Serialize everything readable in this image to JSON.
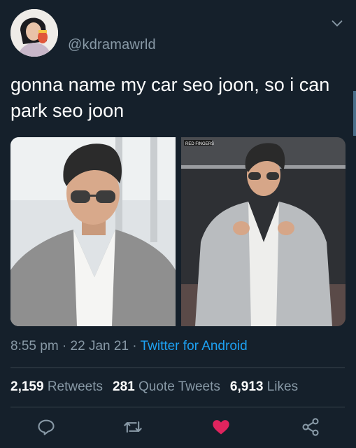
{
  "user": {
    "handle": "@kdramawrld",
    "avatar_icon": "profile-photo"
  },
  "tweet": {
    "text": "gonna name my car seo joon, so i can park seo joon",
    "image_watermark": "RED FINGERS"
  },
  "meta": {
    "time": "8:55 pm",
    "separator": " · ",
    "date": "22 Jan 21",
    "source": "Twitter for Android"
  },
  "stats": {
    "retweets_count": "2,159",
    "retweets_label": "Retweets",
    "quote_count": "281",
    "quote_label": "Quote Tweets",
    "likes_count": "6,913",
    "likes_label": "Likes"
  },
  "actions": {
    "reply_icon": "reply-icon",
    "retweet_icon": "retweet-icon",
    "like_icon": "heart-icon",
    "share_icon": "share-icon",
    "liked": true
  },
  "colors": {
    "background": "#15202b",
    "secondary_text": "#8899a6",
    "link": "#1da1f2",
    "like": "#e0245e",
    "divider": "#38444d"
  }
}
